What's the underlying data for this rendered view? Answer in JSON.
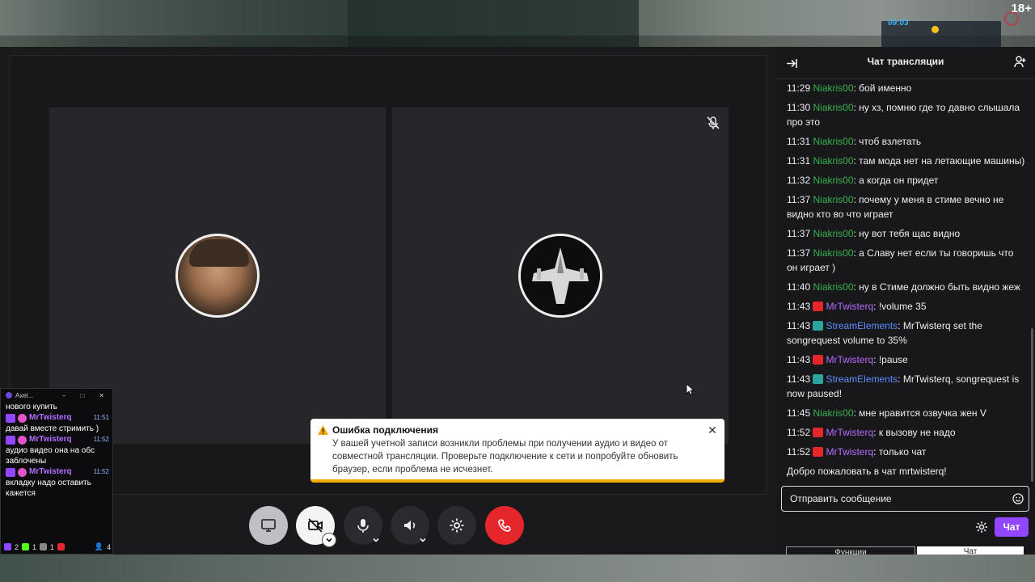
{
  "game": {
    "timer": "09:03",
    "age_rating": "18+"
  },
  "call": {
    "participant_left": "streamer-avatar",
    "participant_right": "ship-avatar"
  },
  "toast": {
    "title": "Ошибка подключения",
    "body": "У вашей учетной записи возникли проблемы при получении аудио и видео от совместной трансляции. Проверьте подключение к сети и попробуйте обновить браузер, если проблема не исчезнет.",
    "accent": "#f2a900"
  },
  "overlay": {
    "title": "Axel...",
    "top_line": "нового купить",
    "messages": [
      {
        "user": "MrTwisterq",
        "time": "11:51",
        "text": "давай вместе стримить )"
      },
      {
        "user": "MrTwisterq",
        "time": "11:52",
        "text": "аудио видео она на обс заблочены"
      },
      {
        "user": "MrTwisterq",
        "time": "11:52",
        "text": "вкладку надо оставить кажется"
      }
    ],
    "stats": {
      "s1": "2",
      "s2": "1",
      "s3": "1",
      "s4": "1",
      "viewers": "4"
    }
  },
  "chat": {
    "title": "Чат трансляции",
    "colors": {
      "niakris": "#37b24d",
      "twister": "#b46cff",
      "streamelements": "#5b8dff"
    },
    "messages": [
      {
        "time": "11:29",
        "user": "Niakris00",
        "kind": "niakris",
        "text": ": бой именно"
      },
      {
        "time": "11:30",
        "user": "Niakris00",
        "kind": "niakris",
        "text": ": ну хз, помню где то давно слышала про это"
      },
      {
        "time": "11:31",
        "user": "Niakris00",
        "kind": "niakris",
        "text": ": чтоб взлетать"
      },
      {
        "time": "11:31",
        "user": "Niakris00",
        "kind": "niakris",
        "text": ": там мода нет на летающие машины)"
      },
      {
        "time": "11:32",
        "user": "Niakris00",
        "kind": "niakris",
        "text": ": а когда он придет"
      },
      {
        "time": "11:37",
        "user": "Niakris00",
        "kind": "niakris",
        "text": ": почему у меня в стиме вечно не видно кто во что играет"
      },
      {
        "time": "11:37",
        "user": "Niakris00",
        "kind": "niakris",
        "text": ": ну вот тебя щас видно"
      },
      {
        "time": "11:37",
        "user": "Niakris00",
        "kind": "niakris",
        "text": ": а Славу нет если ты говоришь что он играет )"
      },
      {
        "time": "11:40",
        "user": "Niakris00",
        "kind": "niakris",
        "text": ": ну в Стиме должно быть видно жеж"
      },
      {
        "time": "11:43",
        "user": "MrTwisterq",
        "kind": "twister",
        "text": ": !volume 35"
      },
      {
        "time": "11:43",
        "user": "StreamElements",
        "kind": "streamelements",
        "text": ": MrTwisterq set the songrequest volume to 35%"
      },
      {
        "time": "11:43",
        "user": "MrTwisterq",
        "kind": "twister",
        "text": ": !pause"
      },
      {
        "time": "11:43",
        "user": "StreamElements",
        "kind": "streamelements",
        "text": ": MrTwisterq, songrequest is now paused!"
      },
      {
        "time": "11:45",
        "user": "Niakris00",
        "kind": "niakris",
        "text": ": мне нравится озвучка жен V"
      },
      {
        "time": "11:52",
        "user": "MrTwisterq",
        "kind": "twister",
        "text": ": к вызову не надо"
      },
      {
        "time": "11:52",
        "user": "MrTwisterq",
        "kind": "twister",
        "text": ": только чат"
      }
    ],
    "welcome": "Добро пожаловать в чат mrtwisterq!",
    "input_placeholder": "Отправить сообщение",
    "send_label": "Чат",
    "tab1": "Функции",
    "tab2": "Чат"
  }
}
